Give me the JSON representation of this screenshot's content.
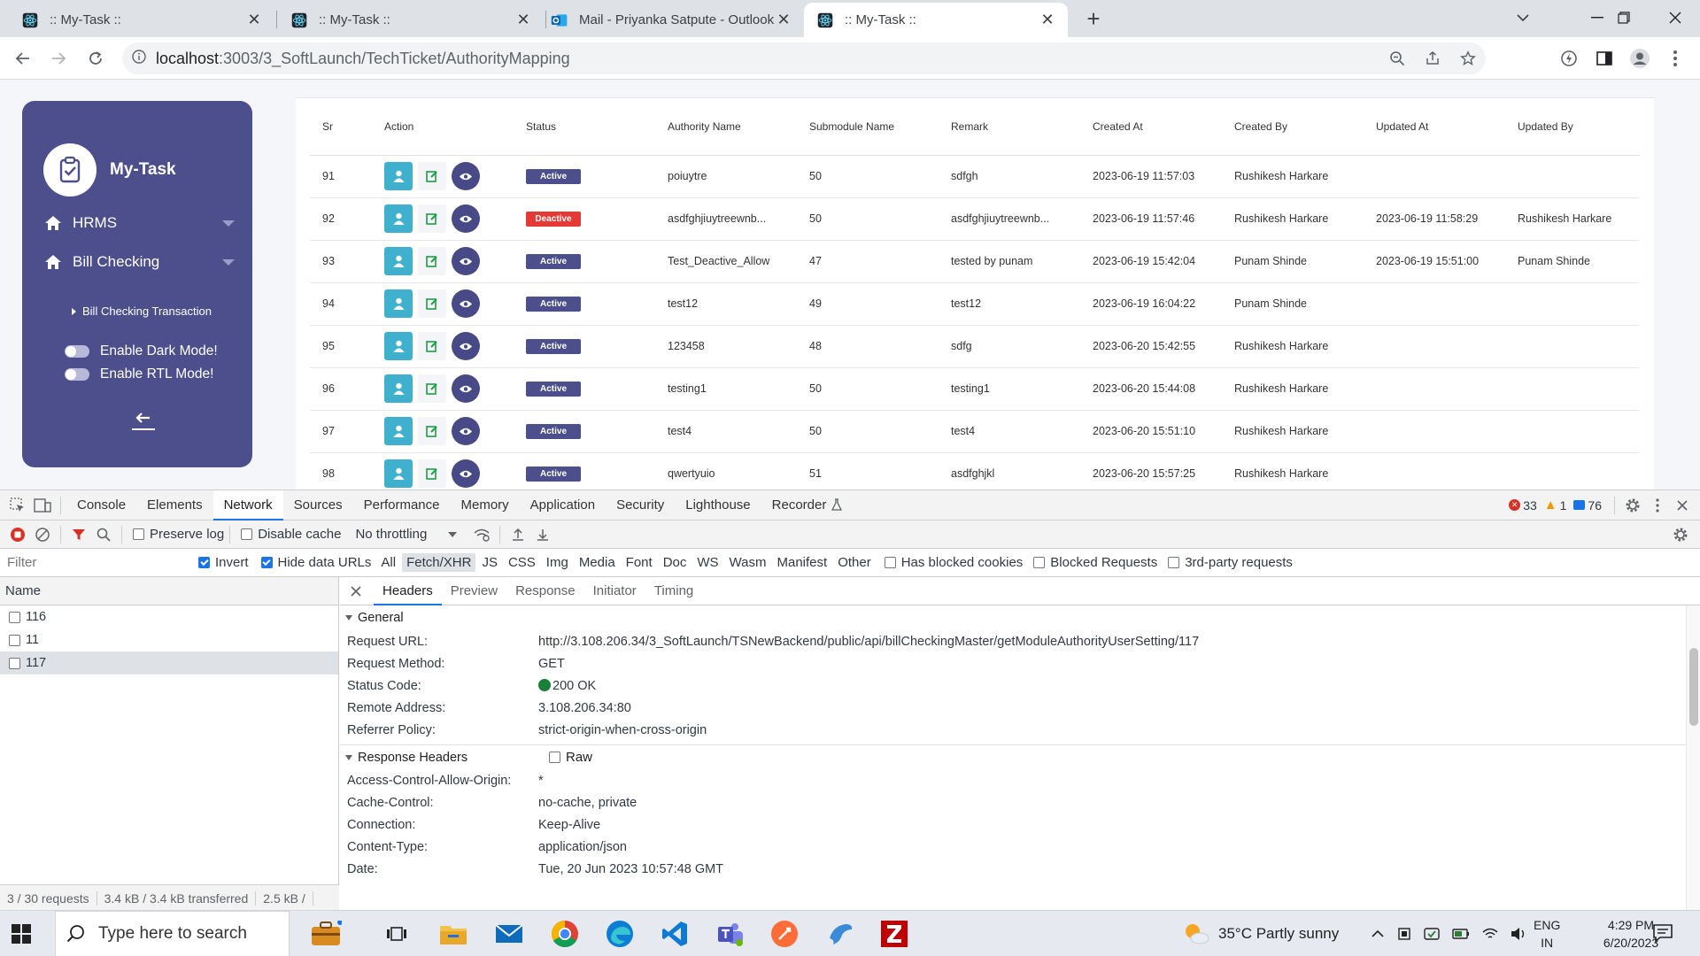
{
  "browser": {
    "tabs": [
      {
        "title": ":: My-Task ::",
        "favicon": "react-icon",
        "active": false
      },
      {
        "title": ":: My-Task ::",
        "favicon": "react-icon",
        "active": false
      },
      {
        "title": "Mail - Priyanka Satpute - Outlook",
        "favicon": "outlook-icon",
        "active": false
      },
      {
        "title": ":: My-Task ::",
        "favicon": "react-icon",
        "active": true
      }
    ],
    "new_tab": "+",
    "url_host": "localhost",
    "url_rest": ":3003/3_SoftLaunch/TechTicket/AuthorityMapping"
  },
  "sidebar": {
    "brand": "My-Task",
    "menu": [
      {
        "label": "HRMS",
        "icon": "home-icon"
      },
      {
        "label": "Bill Checking",
        "icon": "home-icon"
      }
    ],
    "submenu": "Bill Checking Transaction",
    "toggles": [
      "Enable Dark Mode!",
      "Enable RTL Mode!"
    ],
    "colors": {
      "bg": "#4d4f8c"
    }
  },
  "table": {
    "headers": [
      "Sr",
      "Action",
      "Status",
      "Authority Name",
      "Submodule Name",
      "Remark",
      "Created At",
      "Created By",
      "Updated At",
      "Updated By"
    ],
    "rows": [
      {
        "sr": "91",
        "status": "Active",
        "authority": "poiuytre",
        "submodule": "50",
        "remark": "sdfgh",
        "created_at": "2023-06-19 11:57:03",
        "created_by": "Rushikesh Harkare",
        "updated_at": "",
        "updated_by": ""
      },
      {
        "sr": "92",
        "status": "Deactive",
        "authority": "asdfghjiuytreewnb...",
        "submodule": "50",
        "remark": "asdfghjiuytreewnb...",
        "created_at": "2023-06-19 11:57:46",
        "created_by": "Rushikesh Harkare",
        "updated_at": "2023-06-19 11:58:29",
        "updated_by": "Rushikesh Harkare"
      },
      {
        "sr": "93",
        "status": "Active",
        "authority": "Test_Deactive_Allow",
        "submodule": "47",
        "remark": "tested by punam",
        "created_at": "2023-06-19 15:42:04",
        "created_by": "Punam Shinde",
        "updated_at": "2023-06-19 15:51:00",
        "updated_by": "Punam Shinde"
      },
      {
        "sr": "94",
        "status": "Active",
        "authority": "test12",
        "submodule": "49",
        "remark": "test12",
        "created_at": "2023-06-19 16:04:22",
        "created_by": "Punam Shinde",
        "updated_at": "",
        "updated_by": ""
      },
      {
        "sr": "95",
        "status": "Active",
        "authority": "123458",
        "submodule": "48",
        "remark": "sdfg",
        "created_at": "2023-06-20 15:42:55",
        "created_by": "Rushikesh Harkare",
        "updated_at": "",
        "updated_by": ""
      },
      {
        "sr": "96",
        "status": "Active",
        "authority": "testing1",
        "submodule": "50",
        "remark": "testing1",
        "created_at": "2023-06-20 15:44:08",
        "created_by": "Rushikesh Harkare",
        "updated_at": "",
        "updated_by": ""
      },
      {
        "sr": "97",
        "status": "Active",
        "authority": "test4",
        "submodule": "50",
        "remark": "test4",
        "created_at": "2023-06-20 15:51:10",
        "created_by": "Rushikesh Harkare",
        "updated_at": "",
        "updated_by": ""
      },
      {
        "sr": "98",
        "status": "Active",
        "authority": "qwertyuio",
        "submodule": "51",
        "remark": "asdfghjkl",
        "created_at": "2023-06-20 15:57:25",
        "created_by": "Rushikesh Harkare",
        "updated_at": "",
        "updated_by": ""
      }
    ]
  },
  "devtools": {
    "tabs": [
      "Console",
      "Elements",
      "Network",
      "Sources",
      "Performance",
      "Memory",
      "Application",
      "Security",
      "Lighthouse",
      "Recorder"
    ],
    "selected_tab": "Network",
    "counts": {
      "errors": "33",
      "warnings": "1",
      "messages": "76"
    },
    "toolbar": {
      "preserve_log": "Preserve log",
      "disable_cache": "Disable cache",
      "throttling": "No throttling"
    },
    "filter": {
      "placeholder": "Filter",
      "invert": "Invert",
      "hide_data_urls": "Hide data URLs",
      "types": [
        "All",
        "Fetch/XHR",
        "JS",
        "CSS",
        "Img",
        "Media",
        "Font",
        "Doc",
        "WS",
        "Wasm",
        "Manifest",
        "Other"
      ],
      "selected_type": "Fetch/XHR",
      "blocked_cookies": "Has blocked cookies",
      "blocked_requests": "Blocked Requests",
      "third_party": "3rd-party requests"
    },
    "requests": {
      "header": "Name",
      "items": [
        "116",
        "11",
        "117"
      ],
      "selected": "117",
      "footer": [
        "3 / 30 requests",
        "3.4 kB / 3.4 kB transferred",
        "2.5 kB /"
      ]
    },
    "details": {
      "tabs": [
        "Headers",
        "Preview",
        "Response",
        "Initiator",
        "Timing"
      ],
      "selected_tab": "Headers",
      "general_title": "General",
      "general": [
        {
          "k": "Request URL:",
          "v": "http://3.108.206.34/3_SoftLaunch/TSNewBackend/public/api/billCheckingMaster/getModuleAuthorityUserSetting/117"
        },
        {
          "k": "Request Method:",
          "v": "GET"
        },
        {
          "k": "Status Code:",
          "v": "200 OK"
        },
        {
          "k": "Remote Address:",
          "v": "3.108.206.34:80"
        },
        {
          "k": "Referrer Policy:",
          "v": "strict-origin-when-cross-origin"
        }
      ],
      "response_title": "Response Headers",
      "raw_label": "Raw",
      "response": [
        {
          "k": "Access-Control-Allow-Origin:",
          "v": "*"
        },
        {
          "k": "Cache-Control:",
          "v": "no-cache, private"
        },
        {
          "k": "Connection:",
          "v": "Keep-Alive"
        },
        {
          "k": "Content-Type:",
          "v": "application/json"
        },
        {
          "k": "Date:",
          "v": "Tue, 20 Jun 2023 10:57:48 GMT"
        }
      ]
    }
  },
  "taskbar": {
    "search_placeholder": "Type here to search",
    "weather": "35°C  Partly sunny",
    "lang": "ENG",
    "region": "IN",
    "time": "4:29 PM",
    "date": "6/20/2023"
  }
}
